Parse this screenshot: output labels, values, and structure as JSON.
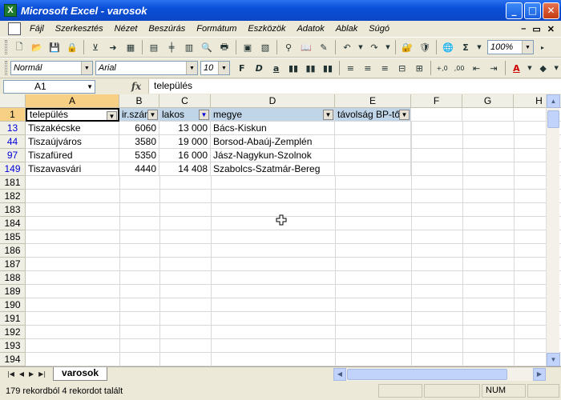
{
  "window": {
    "title": "Microsoft Excel - varosok",
    "app_icon": "excel-icon"
  },
  "menu": [
    "Fájl",
    "Szerkesztés",
    "Nézet",
    "Beszúrás",
    "Formátum",
    "Eszközök",
    "Adatok",
    "Ablak",
    "Súgó"
  ],
  "toolbar": {
    "zoom": "100%",
    "style": "Normál",
    "font": "Arial",
    "size": "10"
  },
  "formula_bar": {
    "name_box": "A1",
    "fx": "fx",
    "value": "település"
  },
  "columns": [
    "A",
    "B",
    "C",
    "D",
    "E",
    "F",
    "G",
    "H"
  ],
  "header_row": {
    "row": "1",
    "cells": [
      "település",
      "ir.szám",
      "lakos",
      "megye",
      "távolság BP-től"
    ]
  },
  "data_rows": [
    {
      "row": "13",
      "cells": [
        "Tiszakécske",
        "6060",
        "13 000",
        "Bács-Kiskun"
      ]
    },
    {
      "row": "44",
      "cells": [
        "Tiszaújváros",
        "3580",
        "19 000",
        "Borsod-Abaúj-Zemplén"
      ]
    },
    {
      "row": "97",
      "cells": [
        "Tiszafüred",
        "5350",
        "16 000",
        "Jász-Nagykun-Szolnok"
      ]
    },
    {
      "row": "149",
      "cells": [
        "Tiszavasvári",
        "4440",
        "14 408",
        "Szabolcs-Szatmár-Bereg"
      ]
    }
  ],
  "empty_rows": [
    "181",
    "182",
    "183",
    "184",
    "185",
    "186",
    "187",
    "188",
    "189",
    "190",
    "191",
    "192",
    "193",
    "194"
  ],
  "sheet_tab": "varosok",
  "status": {
    "message": "179 rekordból 4 rekordot talált",
    "num": "NUM"
  },
  "colors": {
    "accent": "#0a4fd9",
    "selected_header": "#f8d085",
    "filter_header": "#c0d6e8",
    "filtered_row_number": "#0000d8"
  }
}
